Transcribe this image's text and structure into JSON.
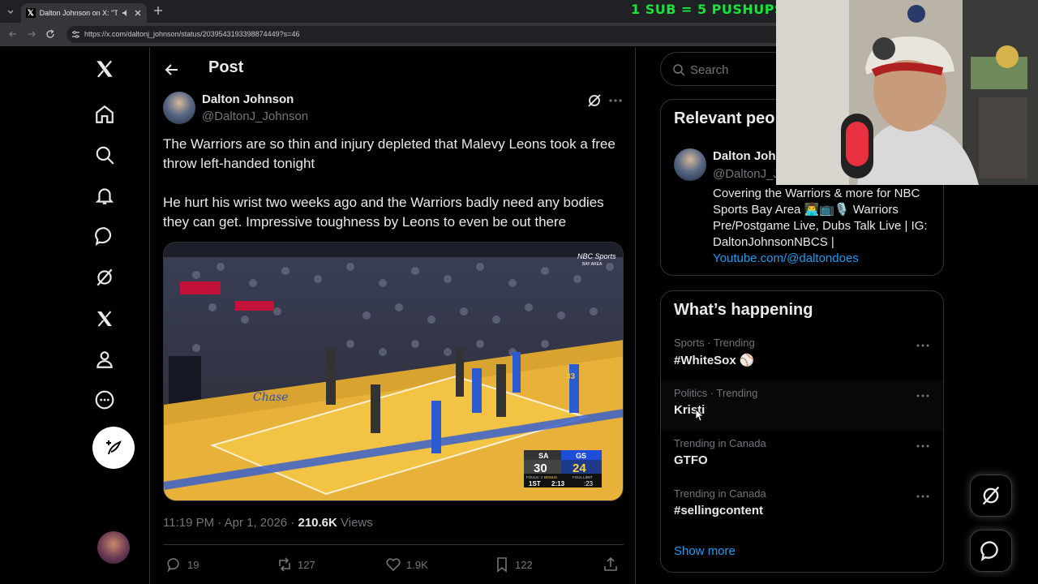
{
  "browser": {
    "tab_title": "Dalton Johnson on X: \"The",
    "url": "https://x.com/daltonj_johnson/status/2039543193398874449?s=46"
  },
  "stream_banner": "1 SUB = 5 PUSHUPS",
  "header": {
    "title": "Post"
  },
  "tweet": {
    "author_name": "Dalton Johnson",
    "author_handle": "@DaltonJ_Johnson",
    "text_p1": "The Warriors are so thin and injury depleted that Malevy Leons took a free throw left-handed tonight",
    "text_p2": "He hurt his wrist two weeks ago and the Warriors badly need any bodies they can get. Impressive toughness by Leons to even be out there",
    "time": "11:19 PM · Apr 1, 2026 · ",
    "views_count": "210.6K",
    "views_label": " Views",
    "replies": "19",
    "reposts": "127",
    "likes": "1.9K",
    "bookmarks": "122"
  },
  "video": {
    "network": "NBC Sports",
    "network_sub": "BAY AREA",
    "away_team": "SA",
    "home_team": "GS",
    "away_score": "30",
    "home_score": "24",
    "quarter": "1ST",
    "clock": "2:13",
    "shot_clock": ":23",
    "fouls_away": "FOULS: 4",
    "bonus": "BONUS",
    "foul_limit": "FOUL LIMIT",
    "court_text": "Chase",
    "jersey_number": "33"
  },
  "search": {
    "placeholder": "Search"
  },
  "relevant": {
    "title": "Relevant peo",
    "name": "Dalton Johnson",
    "handle": "@DaltonJ_Johnson",
    "bio": "Covering the Warriors & more for NBC Sports Bay Area 👨‍💻📺🎙️ Warriors Pre/Postgame Live, Dubs Talk Live | IG: DaltonJohnsonNBCS | ",
    "link": "Youtube.com/@daltondoes"
  },
  "happening": {
    "title": "What’s happening",
    "trends": [
      {
        "category": "Sports · Trending",
        "name": "#WhiteSox ⚾"
      },
      {
        "category": "Politics · Trending",
        "name": "Kristi"
      },
      {
        "category": "Trending in Canada",
        "name": "GTFO"
      },
      {
        "category": "Trending in Canada",
        "name": "#sellingcontent"
      }
    ],
    "show_more": "Show more"
  },
  "colors": {
    "accent": "#1d9bf0",
    "banner": "#18e53a",
    "border": "#2f3336",
    "muted": "#71767b"
  }
}
